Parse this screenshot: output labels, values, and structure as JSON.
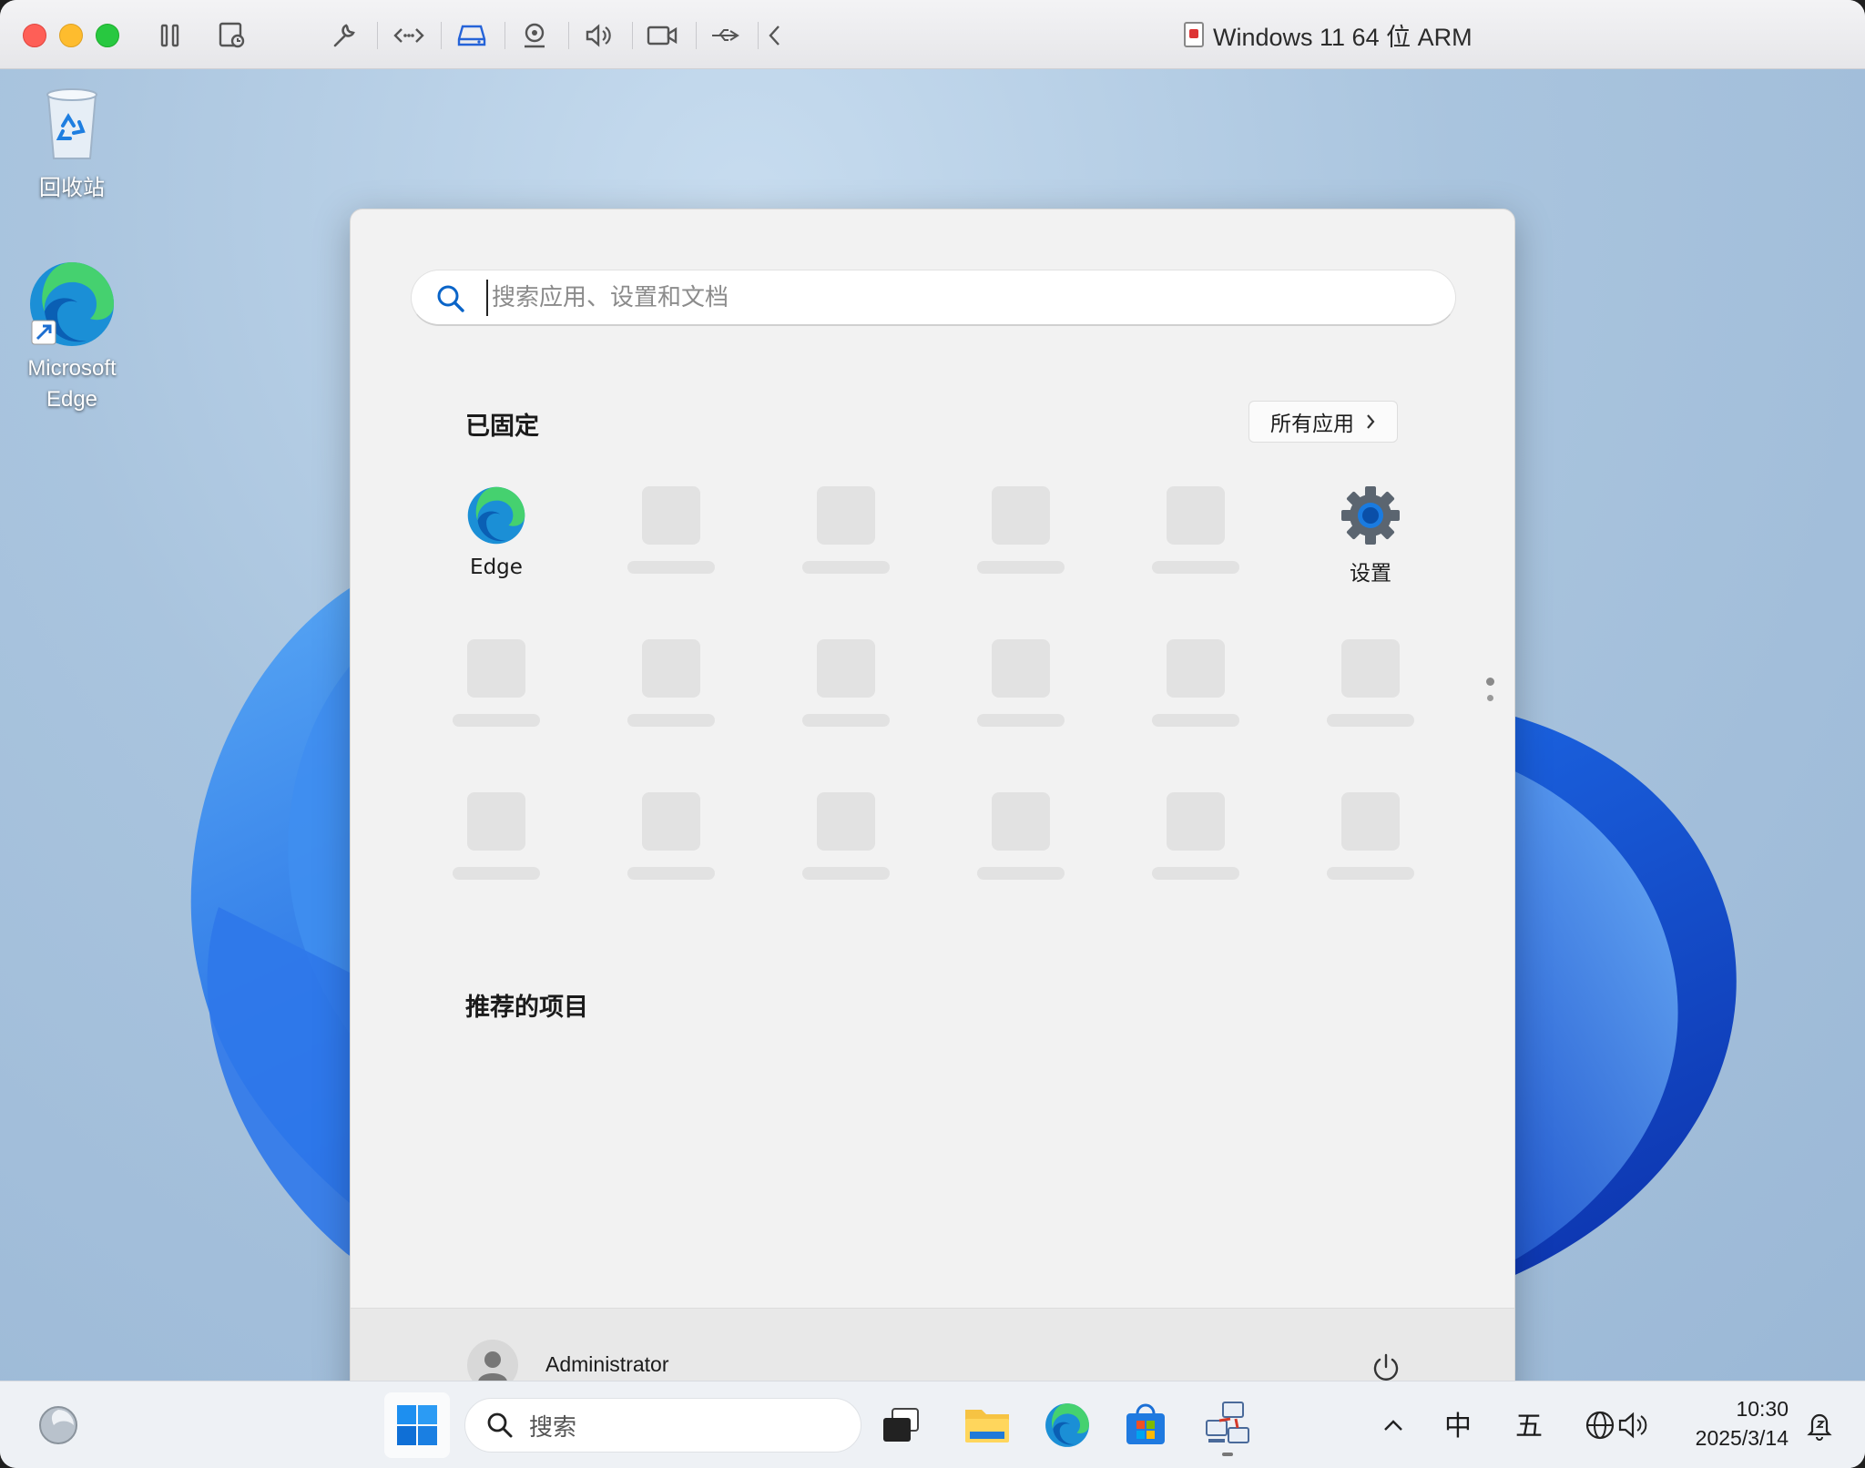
{
  "vm_window": {
    "title": "Windows 11 64 位 ARM",
    "toolbar_icons": [
      "pause-icon",
      "snapshot-icon",
      "wrench-icon",
      "code-icon",
      "drive-icon",
      "camera-icon",
      "speaker-icon",
      "video-icon",
      "usb-icon",
      "back-chevron-icon"
    ]
  },
  "desktop": {
    "icons": [
      {
        "label": "回收站",
        "icon": "recycle-bin-icon"
      },
      {
        "label": "Microsoft Edge",
        "icon": "edge-icon"
      }
    ]
  },
  "start_menu": {
    "search": {
      "placeholder": "搜索应用、设置和文档"
    },
    "pinned": {
      "title": "已固定",
      "all_apps_label": "所有应用",
      "apps": [
        {
          "label": "Edge",
          "icon": "edge-icon"
        },
        {
          "label": "设置",
          "icon": "settings-gear-icon"
        }
      ]
    },
    "recommended": {
      "title": "推荐的项目"
    },
    "footer": {
      "user_name": "Administrator"
    }
  },
  "ime_bar": {
    "mode": "中"
  },
  "taskbar": {
    "search_label": "搜索",
    "tray": {
      "ime_mode": "中",
      "ime_scheme": "五",
      "time": "10:30",
      "date": "2025/3/14"
    }
  },
  "colors": {
    "accent": "#0078d4",
    "menu_bg": "#f2f2f2",
    "taskbar_bg": "#eef1f5"
  }
}
